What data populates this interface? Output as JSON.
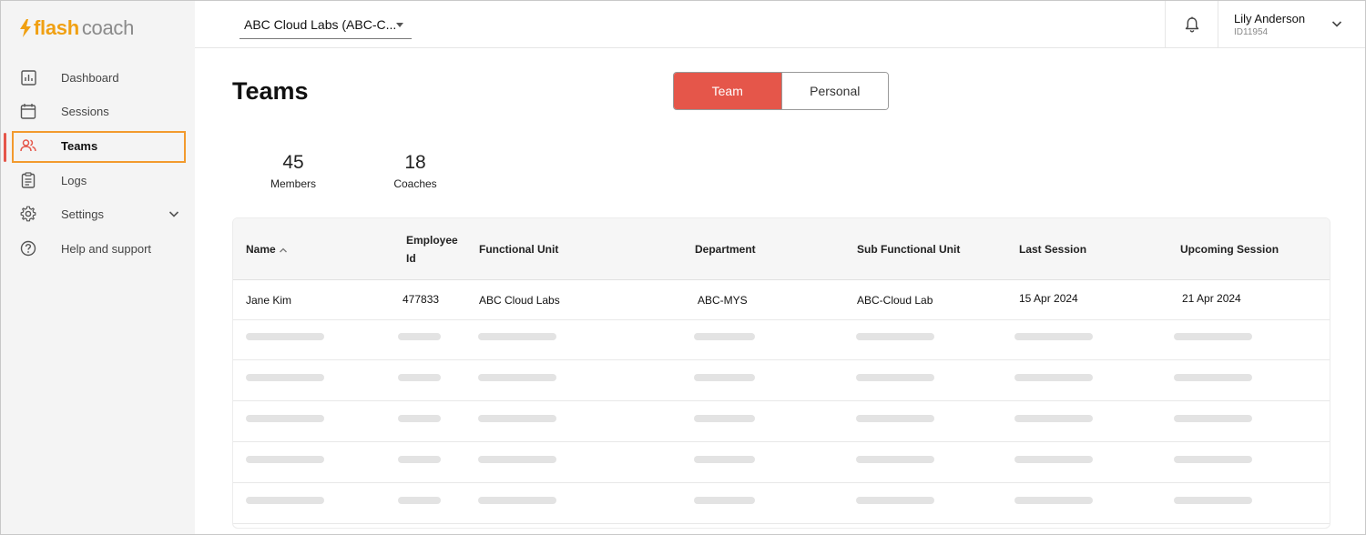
{
  "brand": {
    "flash": "flash",
    "coach": "coach",
    "accent": "#f0a012"
  },
  "sidebar": {
    "items": [
      {
        "label": "Dashboard",
        "icon": "bar-chart-icon"
      },
      {
        "label": "Sessions",
        "icon": "calendar-icon"
      },
      {
        "label": "Teams",
        "icon": "people-icon",
        "active": true
      },
      {
        "label": "Logs",
        "icon": "clipboard-icon"
      },
      {
        "label": "Settings",
        "icon": "gear-icon",
        "expandable": true
      },
      {
        "label": "Help and support",
        "icon": "help-circle-icon"
      }
    ]
  },
  "topbar": {
    "org_select": "ABC Cloud Labs (ABC-C...",
    "user": {
      "name": "Lily Anderson",
      "id": "ID11954"
    }
  },
  "page": {
    "title": "Teams",
    "toggle": {
      "team": "Team",
      "personal": "Personal",
      "selected": "Team"
    },
    "stats": [
      {
        "value": "45",
        "label": "Members"
      },
      {
        "value": "18",
        "label": "Coaches"
      }
    ]
  },
  "table": {
    "headers": {
      "name": "Name",
      "employee_id_1": "Employee",
      "employee_id_2": "Id",
      "functional_unit": "Functional Unit",
      "department": "Department",
      "sub_functional_unit": "Sub Functional Unit",
      "last_session": "Last Session",
      "upcoming_session": "Upcoming Session"
    },
    "sort": {
      "column": "Name",
      "direction": "ascending"
    },
    "rows": [
      {
        "name": "Jane Kim",
        "employee_id": "477833",
        "functional_unit": "ABC Cloud Labs",
        "department": "ABC-MYS",
        "sub_functional_unit": "ABC-Cloud Lab",
        "last_session": "15 Apr 2024",
        "upcoming_session": "21 Apr 2024"
      }
    ],
    "loading_rows": 5
  },
  "colors": {
    "primary": "#e5564a",
    "highlight_outline": "#f29a2e"
  }
}
